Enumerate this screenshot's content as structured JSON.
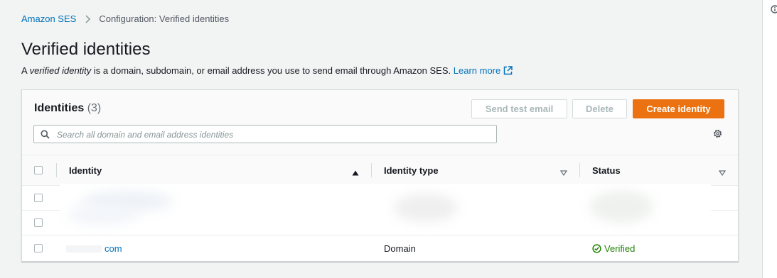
{
  "breadcrumb": {
    "root": "Amazon SES",
    "current": "Configuration: Verified identities"
  },
  "page": {
    "title": "Verified identities",
    "desc_prefix": "A ",
    "desc_em": "verified identity",
    "desc_suffix": " is a domain, subdomain, or email address you use to send email through Amazon SES.",
    "learn_more": "Learn more"
  },
  "panel": {
    "title": "Identities",
    "count": "(3)",
    "buttons": {
      "send_test": "Send test email",
      "delete": "Delete",
      "create": "Create identity"
    },
    "search_placeholder": "Search all domain and email address identities"
  },
  "table": {
    "columns": {
      "identity": "Identity",
      "type": "Identity type",
      "status": "Status"
    },
    "sort": {
      "column": "identity",
      "direction": "ascending"
    },
    "rows": [
      {
        "identity": "",
        "type": "",
        "status": "",
        "redacted": true
      },
      {
        "identity": "",
        "type": "",
        "status": "",
        "redacted": true
      },
      {
        "identity": "com",
        "type": "Domain",
        "status": "Verified",
        "redacted": false
      }
    ]
  },
  "colors": {
    "accent": "#ec7211",
    "link": "#0073bb",
    "success": "#1d8102",
    "background": "#f2f3f3"
  },
  "icons": {
    "breadcrumb_separator": "chevron-right-icon",
    "external_link": "external-link-icon",
    "search": "search-icon",
    "preferences": "gear-icon",
    "sort_ascending": "caret-up-icon",
    "sort_none": "caret-down-icon",
    "verified": "check-circle-icon",
    "info": "info-icon"
  }
}
